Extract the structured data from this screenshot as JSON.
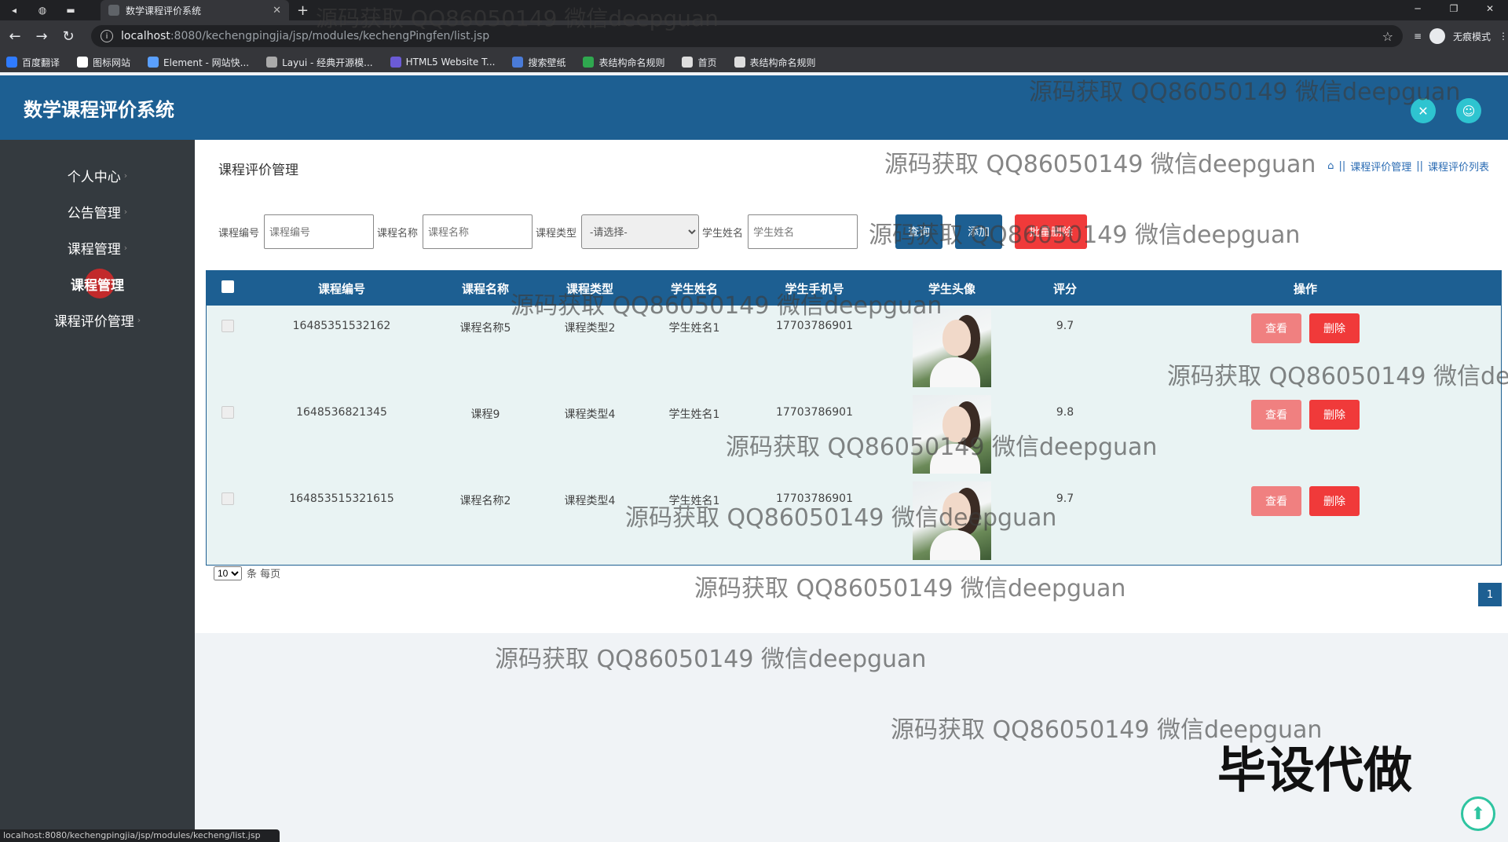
{
  "browser": {
    "tab_title": "数学课程评价系统",
    "url_host": "localhost",
    "url_rest": ":8080/kechengpingjia/jsp/modules/kechengPingfen/list.jsp",
    "profile_label": "无痕模式",
    "bookmarks": [
      "百度翻译",
      "图标网站",
      "Element - 网站快...",
      "Layui - 经典开源模...",
      "HTML5 Website T...",
      "搜索壁纸",
      "表结构命名规则",
      "首页",
      "表结构命名规则"
    ],
    "bookmark_colors": [
      "#2f7bff",
      "#ffffff",
      "#5aa0ff",
      "#aaaaaa",
      "#6b5bd6",
      "#4a7bd8",
      "#2fa84f",
      "#dddddd",
      "#dddddd"
    ],
    "status_url": "localhost:8080/kechengpingjia/jsp/modules/kecheng/list.jsp"
  },
  "app": {
    "title": "数学课程评价系统"
  },
  "sidebar": {
    "items": [
      {
        "label": "个人中心"
      },
      {
        "label": "公告管理"
      },
      {
        "label": "课程管理"
      },
      {
        "label": "课程管理"
      },
      {
        "label": "课程评价管理"
      }
    ]
  },
  "page": {
    "title": "课程评价管理",
    "breadcrumb": [
      "课程评价管理",
      "课程评价列表"
    ]
  },
  "filters": {
    "course_no_label": "课程编号",
    "course_no_placeholder": "课程编号",
    "course_name_label": "课程名称",
    "course_name_placeholder": "课程名称",
    "course_type_label": "课程类型",
    "course_type_selected": "-请选择-",
    "student_name_label": "学生姓名",
    "student_name_placeholder": "学生姓名",
    "query_label": "查询",
    "add_label": "添加",
    "batch_delete_label": "批量删除"
  },
  "table": {
    "headers": [
      "课程编号",
      "课程名称",
      "课程类型",
      "学生姓名",
      "学生手机号",
      "学生头像",
      "评分",
      "操作"
    ],
    "rows": [
      {
        "course_no": "16485351532162",
        "course_name": "课程名称5",
        "course_type": "课程类型2",
        "student_name": "学生姓名1",
        "phone": "17703786901",
        "score": "9.7"
      },
      {
        "course_no": "1648536821345",
        "course_name": "课程9",
        "course_type": "课程类型4",
        "student_name": "学生姓名1",
        "phone": "17703786901",
        "score": "9.8"
      },
      {
        "course_no": "164853515321615",
        "course_name": "课程名称2",
        "course_type": "课程类型4",
        "student_name": "学生姓名1",
        "phone": "17703786901",
        "score": "9.7"
      }
    ],
    "view_label": "查看",
    "delete_label": "删除"
  },
  "pagination": {
    "page_size": "10",
    "per_page_label": "条 每页",
    "current_page": "1"
  },
  "watermark": "源码获取 QQ86050149 微信deepguan",
  "promo": "毕设代做",
  "colors": {
    "header": "#1d5f92",
    "sidebar": "#343a3f",
    "danger": "#f03a3a",
    "view": "#f08080",
    "accent": "#2ec4d0"
  }
}
